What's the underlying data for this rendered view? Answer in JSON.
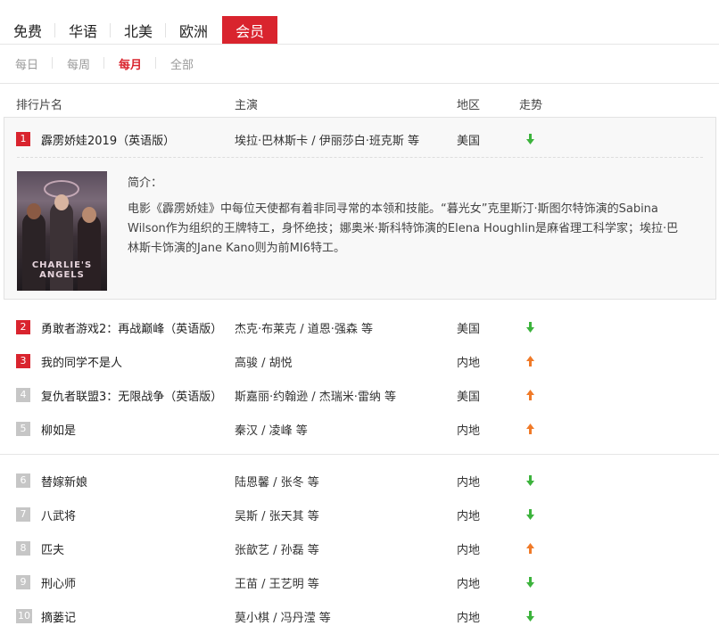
{
  "category_tabs": [
    "免费",
    "华语",
    "北美",
    "欧洲",
    "会员"
  ],
  "period_tabs": [
    "每日",
    "每周",
    "每月",
    "全部"
  ],
  "headers": {
    "title": "排行片名",
    "cast": "主演",
    "region": "地区",
    "trend": "走势"
  },
  "expanded": {
    "rank": "1",
    "title": "霹雳娇娃2019（英语版）",
    "cast": "埃拉·巴林斯卡 / 伊丽莎白·班克斯 等",
    "region": "美国",
    "trend": "down",
    "intro_label": "简介：",
    "intro": "电影《霹雳娇娃》中每位天使都有着非同寻常的本领和技能。“暮光女”克里斯汀·斯图尔特饰演的Sabina Wilson作为组织的王牌特工，身怀绝技；娜奥米·斯科特饰演的Elena Houghlin是麻省理工科学家；埃拉·巴林斯卡饰演的Jane Kano则为前MI6特工。",
    "poster_text": "CHARLIE'S ANGELS"
  },
  "rows": [
    {
      "rank": "2",
      "title": "勇敢者游戏2：再战巅峰（英语版）",
      "cast": "杰克·布莱克 / 道恩·强森 等",
      "region": "美国",
      "trend": "down"
    },
    {
      "rank": "3",
      "title": "我的同学不是人",
      "cast": "高骏 / 胡悦",
      "region": "内地",
      "trend": "up"
    },
    {
      "rank": "4",
      "title": "复仇者联盟3：无限战争（英语版）",
      "cast": "斯嘉丽·约翰逊 / 杰瑞米·雷纳 等",
      "region": "美国",
      "trend": "up"
    },
    {
      "rank": "5",
      "title": "柳如是",
      "cast": "秦汉 / 凌峰 等",
      "region": "内地",
      "trend": "up"
    },
    {
      "rank": "6",
      "title": "替嫁新娘",
      "cast": "陆恩馨 / 张冬 等",
      "region": "内地",
      "trend": "down"
    },
    {
      "rank": "7",
      "title": "八武将",
      "cast": "吴斯 / 张天其 等",
      "region": "内地",
      "trend": "down"
    },
    {
      "rank": "8",
      "title": "匹夫",
      "cast": "张歆艺 / 孙磊 等",
      "region": "内地",
      "trend": "up"
    },
    {
      "rank": "9",
      "title": "刑心师",
      "cast": "王苗 / 王艺明 等",
      "region": "内地",
      "trend": "down"
    },
    {
      "rank": "10",
      "title": "摘蒌记",
      "cast": "莫小棋 / 冯丹滢 等",
      "region": "内地",
      "trend": "down"
    }
  ],
  "colors": {
    "accent": "#d9242e",
    "trend_up": "#f07a28",
    "trend_down": "#3cb33c",
    "rank_gray": "#c6c6c6"
  },
  "icons": {
    "trend_up": "arrow-up-icon",
    "trend_down": "arrow-down-icon"
  }
}
